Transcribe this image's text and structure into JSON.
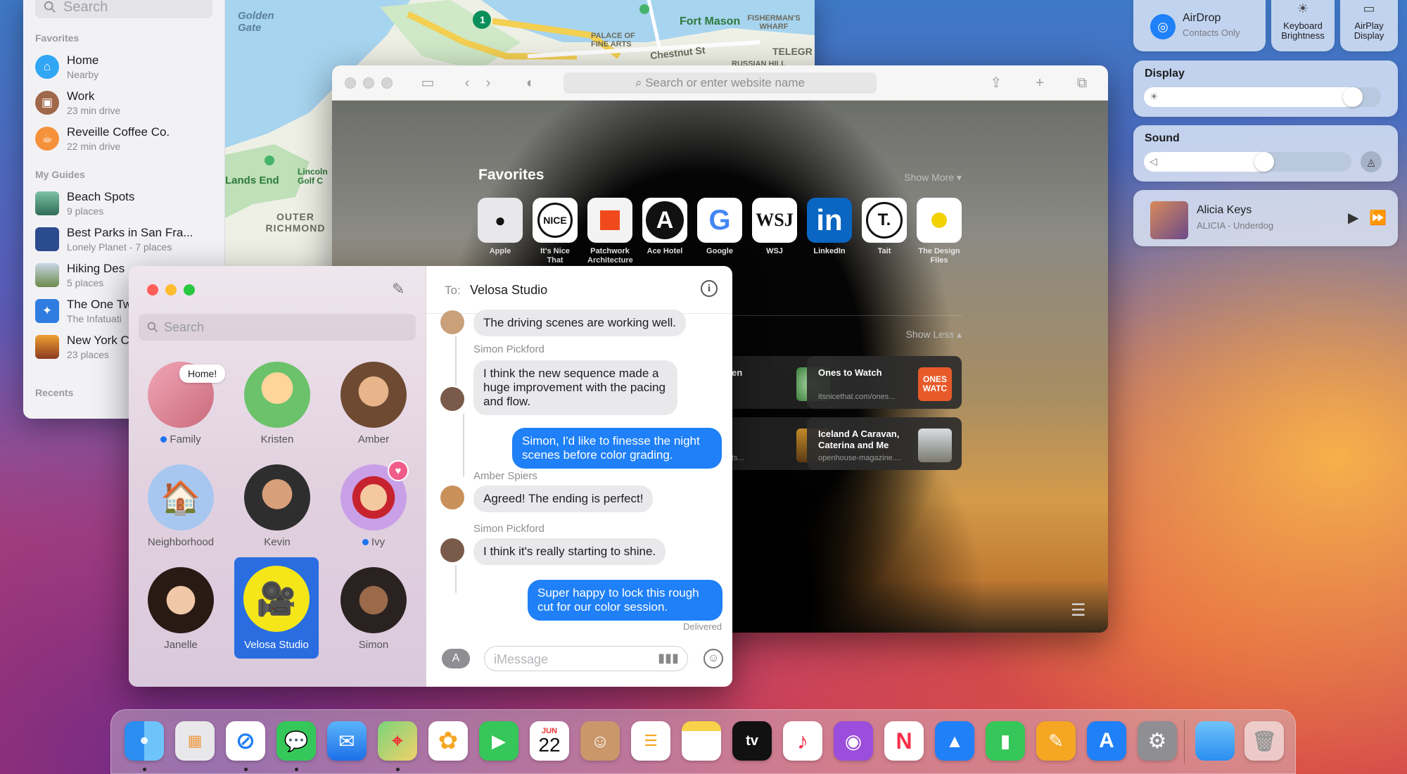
{
  "maps": {
    "search_placeholder": "Search",
    "favorites_header": "Favorites",
    "favorites": [
      {
        "title": "Home",
        "subtitle": "Nearby",
        "color": "#31a6f5",
        "icon": "house-icon"
      },
      {
        "title": "Work",
        "subtitle": "23 min drive",
        "color": "#a0684a",
        "icon": "briefcase-icon"
      },
      {
        "title": "Reveille Coffee Co.",
        "subtitle": "22 min drive",
        "color": "#f4913a",
        "icon": "cup-icon"
      }
    ],
    "guides_header": "My Guides",
    "guides": [
      {
        "title": "Beach Spots",
        "subtitle": "9 places"
      },
      {
        "title": "Best Parks in San Fra...",
        "subtitle": "Lonely Planet - 7 places"
      },
      {
        "title": "Hiking Des",
        "subtitle": "5 places"
      },
      {
        "title": "The One Tw",
        "subtitle": "The Infatuati"
      },
      {
        "title": "New York C",
        "subtitle": "23 places"
      }
    ],
    "recents_header": "Recents",
    "map_labels": {
      "golden_gate": "Golden Gate",
      "fort_mason": "Fort Mason",
      "fishermans": "FISHERMAN'S WHARF",
      "palace": "PALACE OF FINE ARTS",
      "chestnut": "Chestnut St",
      "lands_end": "Lands End",
      "lincoln": "Lincoln Golf C",
      "outer": "OUTER RICHMOND",
      "russian": "RUSSIAN HILL",
      "telegraph": "TELEGR",
      "route": "1"
    }
  },
  "safari": {
    "url_placeholder": "Search or enter website name",
    "favorites_title": "Favorites",
    "show_more": "Show More",
    "show_less": "Show Less",
    "favorites": [
      {
        "label": "Apple",
        "glyph": "",
        "bg": "#ffffff",
        "fg": "#111111"
      },
      {
        "label": "It's Nice That",
        "glyph": "NICE",
        "bg": "#ffffff",
        "fg": "#111111"
      },
      {
        "label": "Patchwork Architecture",
        "glyph": "",
        "bg": "#f3f3f3",
        "fg": "#f04a1c"
      },
      {
        "label": "Ace Hotel",
        "glyph": "A",
        "bg": "#ffffff",
        "fg": "#111111"
      },
      {
        "label": "Google",
        "glyph": "G",
        "bg": "#ffffff",
        "fg": "#4285f4"
      },
      {
        "label": "WSJ",
        "glyph": "WSJ",
        "bg": "#ffffff",
        "fg": "#111111"
      },
      {
        "label": "LinkedIn",
        "glyph": "in",
        "bg": "#0a66c2",
        "fg": "#ffffff"
      },
      {
        "label": "Tait",
        "glyph": "T.",
        "bg": "#ffffff",
        "fg": "#111111"
      },
      {
        "label": "The Design Files",
        "glyph": "",
        "bg": "#ffffff",
        "fg": "#f2d200"
      }
    ],
    "reading": [
      {
        "title": "en",
        "sub": ""
      },
      {
        "title": "Ones to Watch",
        "sub": "itsnicethat.com/ones..."
      },
      {
        "title": "",
        "sub": "ts..."
      },
      {
        "title": "Iceland A Caravan, Caterina and Me",
        "sub": "openhouse-magazine...."
      }
    ],
    "thumb_text": "ONES WATC"
  },
  "messages": {
    "search_placeholder": "Search",
    "pins": [
      {
        "name": "Family",
        "dot": true,
        "bubble": "Home!"
      },
      {
        "name": "Kristen",
        "dot": false
      },
      {
        "name": "Amber",
        "dot": false
      },
      {
        "name": "Neighborhood",
        "dot": false
      },
      {
        "name": "Kevin",
        "dot": false
      },
      {
        "name": "Ivy",
        "dot": true
      },
      {
        "name": "Janelle",
        "dot": false
      },
      {
        "name": "Velosa Studio",
        "dot": false,
        "selected": true
      },
      {
        "name": "Simon",
        "dot": false
      }
    ],
    "to_label": "To:",
    "to_name": "Velosa Studio",
    "convo": [
      {
        "type": "in",
        "text": "The driving scenes are working well."
      },
      {
        "type": "sender",
        "text": "Simon Pickford"
      },
      {
        "type": "in",
        "text": "I think the new sequence made a huge improvement with the pacing and flow."
      },
      {
        "type": "out",
        "text": "Simon, I'd like to finesse the night scenes before color grading."
      },
      {
        "type": "sender",
        "text": "Amber Spiers"
      },
      {
        "type": "in",
        "text": "Agreed! The ending is perfect!"
      },
      {
        "type": "sender",
        "text": "Simon Pickford"
      },
      {
        "type": "in",
        "text": "I think it's really starting to shine."
      },
      {
        "type": "out",
        "text": "Super happy to lock this rough cut for our color session."
      }
    ],
    "delivered": "Delivered",
    "input_placeholder": "iMessage"
  },
  "control_center": {
    "airdrop_title": "AirDrop",
    "airdrop_sub": "Contacts Only",
    "kb_label": "Keyboard Brightness",
    "airplay_label": "AirPlay Display",
    "display_label": "Display",
    "display_level": 0.88,
    "sound_label": "Sound",
    "sound_level": 0.58,
    "now_playing_artist": "Alicia Keys",
    "now_playing_track": "ALICIA - Underdog"
  },
  "dock": {
    "calendar_month": "JUN",
    "calendar_day": "22",
    "tv_label": "tv"
  }
}
